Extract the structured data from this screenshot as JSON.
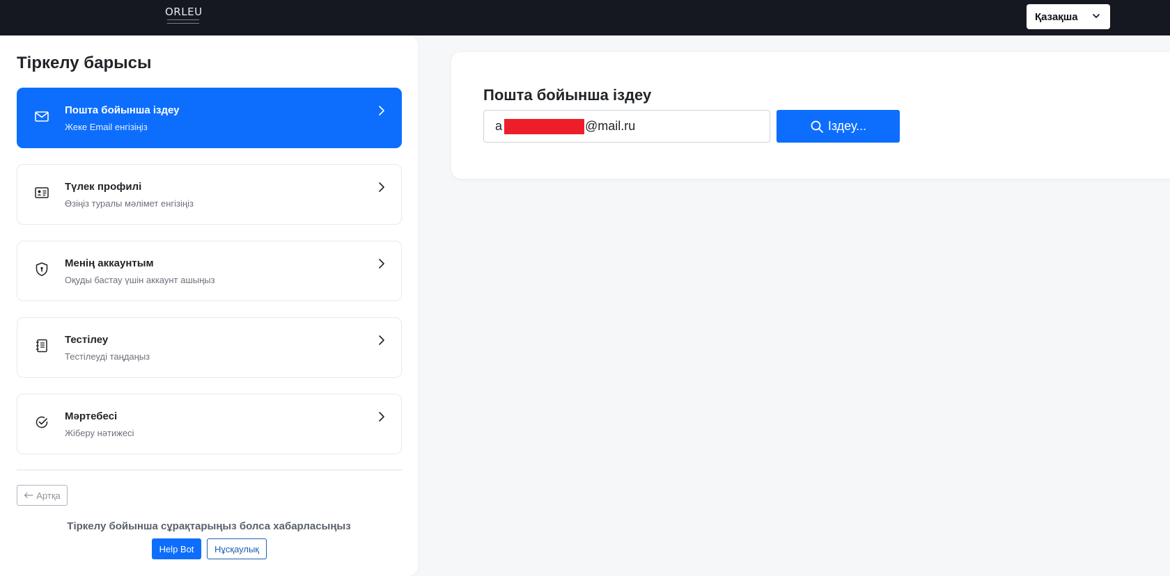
{
  "header": {
    "logo_text": "ORLEU",
    "language": "Қазақша"
  },
  "sidebar": {
    "title": "Тіркелу барысы",
    "steps": [
      {
        "title": "Пошта бойынша іздеу",
        "subtitle": "Жеке Email енгізіңіз",
        "icon": "envelope-icon",
        "active": true
      },
      {
        "title": "Түлек профилі",
        "subtitle": "Өзіңіз туралы мәлімет енгізіңіз",
        "icon": "id-card-icon",
        "active": false
      },
      {
        "title": "Менің аккаунтым",
        "subtitle": "Оқуды бастау үшін аккаунт ашыңыз",
        "icon": "shield-icon",
        "active": false
      },
      {
        "title": "Тестілеу",
        "subtitle": "Тестілеуді таңдаңыз",
        "icon": "notebook-icon",
        "active": false
      },
      {
        "title": "Мәртебесі",
        "subtitle": "Жіберу нәтижесі",
        "icon": "check-circle-icon",
        "active": false
      }
    ],
    "back_label": "Артқа",
    "contact_text": "Тіркелу бойынша сұрақтарыңыз болса хабарласыңыз",
    "help_bot_label": "Help Bot",
    "guide_label": "Нұсқаулық"
  },
  "main": {
    "title": "Пошта бойынша іздеу",
    "email_prefix": "a",
    "email_suffix": "@mail.ru",
    "search_label": "Іздеу..."
  },
  "colors": {
    "accent": "#0d6efd",
    "topbar": "#151821",
    "redaction": "#ee1d2a"
  }
}
